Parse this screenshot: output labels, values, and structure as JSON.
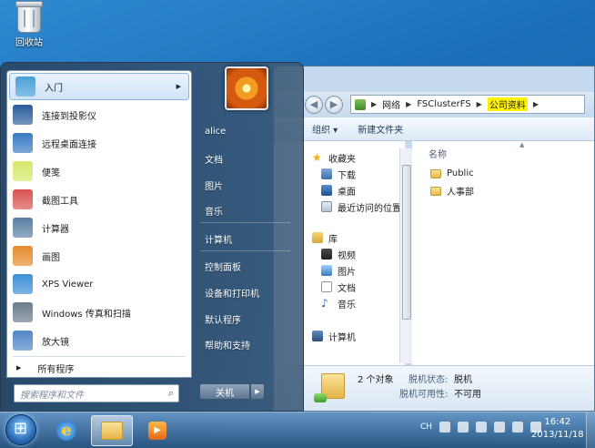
{
  "desktop": {
    "recycle_bin_label": "回收站"
  },
  "explorer": {
    "breadcrumb": [
      "网络",
      "FSClusterFS",
      "公司资料"
    ],
    "toolbar": {
      "organize": "组织 ▾",
      "new_folder": "新建文件夹"
    },
    "nav": {
      "favorites": "收藏夹",
      "downloads": "下载",
      "desktop": "桌面",
      "recent": "最近访问的位置",
      "libraries": "库",
      "videos": "视频",
      "pictures": "图片",
      "documents": "文档",
      "music": "音乐",
      "computer": "计算机"
    },
    "column_name": "名称",
    "files": [
      "Public",
      "人事部"
    ],
    "details": {
      "count": "2 个对象",
      "offline_status_label": "脱机状态:",
      "offline_status_value": "脱机",
      "offline_avail_label": "脱机可用性:",
      "offline_avail_value": "不可用"
    }
  },
  "start_menu": {
    "programs": [
      {
        "label": "入门",
        "icon": "getting-started-icon",
        "color": "#4aa0d8",
        "arrow": "▶"
      },
      {
        "label": "连接到投影仪",
        "icon": "projector-icon",
        "color": "#2a5d9a",
        "arrow": ""
      },
      {
        "label": "远程桌面连接",
        "icon": "remote-desktop-icon",
        "color": "#3a7bc2",
        "arrow": ""
      },
      {
        "label": "便笺",
        "icon": "sticky-notes-icon",
        "color": "#d7e86a",
        "arrow": ""
      },
      {
        "label": "截图工具",
        "icon": "snipping-tool-icon",
        "color": "#d9534f",
        "arrow": ""
      },
      {
        "label": "计算器",
        "icon": "calculator-icon",
        "color": "#5b7fa3",
        "arrow": ""
      },
      {
        "label": "画图",
        "icon": "paint-icon",
        "color": "#e58a2d",
        "arrow": ""
      },
      {
        "label": "XPS Viewer",
        "icon": "xps-viewer-icon",
        "color": "#3d8ed8",
        "arrow": ""
      },
      {
        "label": "Windows 传真和扫描",
        "icon": "fax-scan-icon",
        "color": "#6b7b8c",
        "arrow": ""
      },
      {
        "label": "放大镜",
        "icon": "magnifier-icon",
        "color": "#4f86c6",
        "arrow": ""
      }
    ],
    "all_programs": "所有程序",
    "all_programs_arrow": "▶",
    "search_placeholder": "搜索程序和文件",
    "right_items": [
      "alice",
      "文档",
      "图片",
      "音乐",
      "计算机",
      "控制面板",
      "设备和打印机",
      "默认程序",
      "帮助和支持"
    ],
    "shutdown": "关机",
    "shutdown_arrow": "▶"
  },
  "tray": {
    "language": "CH",
    "time": "16:42",
    "date": "2013/11/18"
  }
}
